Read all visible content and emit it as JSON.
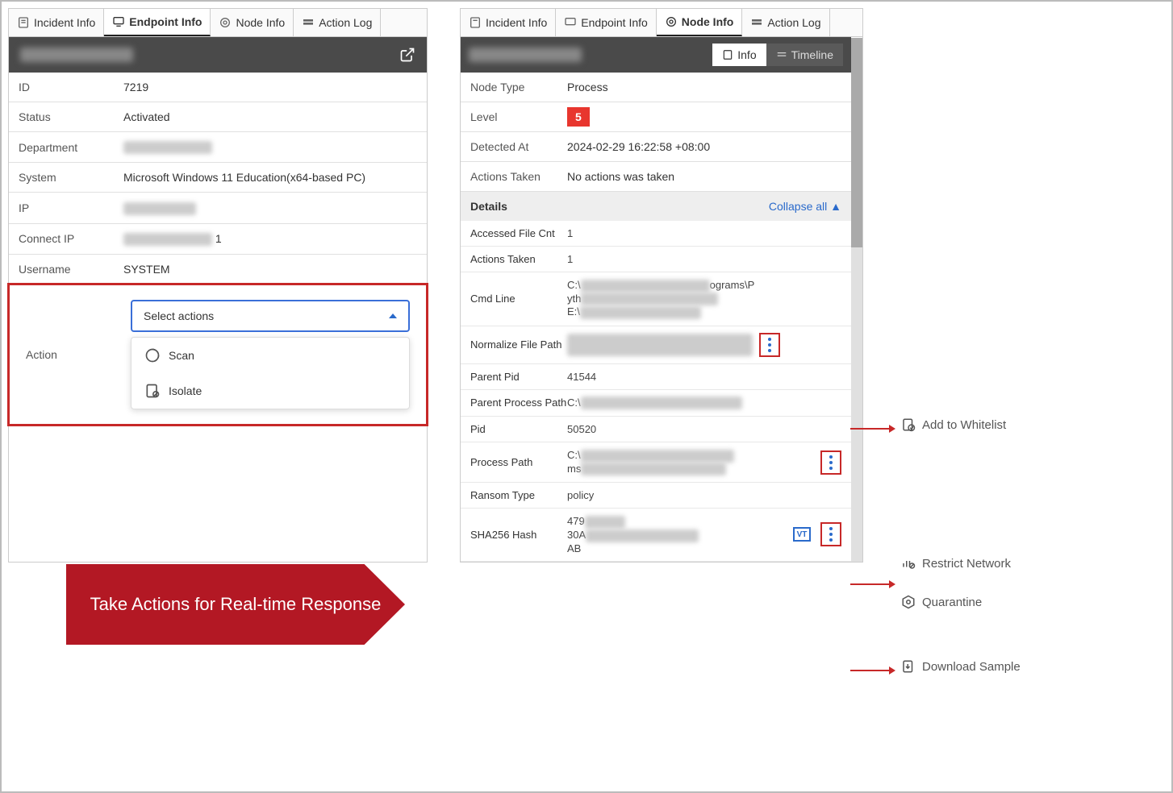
{
  "left": {
    "tabs": [
      {
        "label": "Incident Info"
      },
      {
        "label": "Endpoint Info"
      },
      {
        "label": "Node Info"
      },
      {
        "label": "Action Log"
      }
    ],
    "fields": {
      "id_label": "ID",
      "id_value": "7219",
      "status_label": "Status",
      "status_value": "Activated",
      "department_label": "Department",
      "system_label": "System",
      "system_value": "Microsoft Windows 11 Education(x64-based PC)",
      "ip_label": "IP",
      "connectip_label": "Connect IP",
      "connectip_suffix": "1",
      "username_label": "Username",
      "username_value": "SYSTEM",
      "action_label": "Action",
      "dropdown_placeholder": "Select actions",
      "menu_scan": "Scan",
      "menu_isolate": "Isolate"
    }
  },
  "right": {
    "tabs": [
      {
        "label": "Incident Info"
      },
      {
        "label": "Endpoint Info"
      },
      {
        "label": "Node Info"
      },
      {
        "label": "Action Log"
      }
    ],
    "toggle": {
      "info": "Info",
      "timeline": "Timeline"
    },
    "fields": {
      "nodetype_label": "Node Type",
      "nodetype_value": "Process",
      "level_label": "Level",
      "level_value": "5",
      "detected_label": "Detected At",
      "detected_value": "2024-02-29 16:22:58 +08:00",
      "actionstaken_label": "Actions Taken",
      "actionstaken_value": "No actions was taken",
      "details_header": "Details",
      "collapse_label": "Collapse all"
    },
    "details": {
      "accessed_label": "Accessed File Cnt",
      "accessed_value": "1",
      "actions_label": "Actions Taken",
      "actions_value": "1",
      "cmdline_label": "Cmd Line",
      "cmdline_prefix": "C:\\",
      "cmdline_mid": "ograms\\P",
      "cmdline_l2": "yth",
      "cmdline_l3": "E:\\",
      "normfile_label": "Normalize File Path",
      "parentpid_label": "Parent Pid",
      "parentpid_value": "41544",
      "parentpath_label": "Parent Process Path",
      "parentpath_prefix": "C:\\",
      "pid_label": "Pid",
      "pid_value": "50520",
      "procpath_label": "Process Path",
      "procpath_prefix": "C:\\",
      "procpath_l2": "ms",
      "ransom_label": "Ransom Type",
      "ransom_value": "policy",
      "sha_label": "SHA256 Hash",
      "sha_l1": "479",
      "sha_l2": "30A",
      "sha_l3": "AB"
    }
  },
  "ribbon": "Take Actions for Real-time Response",
  "callouts": {
    "whitelist": "Add to Whitelist",
    "restrict": "Restrict Network",
    "quarantine": "Quarantine",
    "download": "Download Sample"
  }
}
